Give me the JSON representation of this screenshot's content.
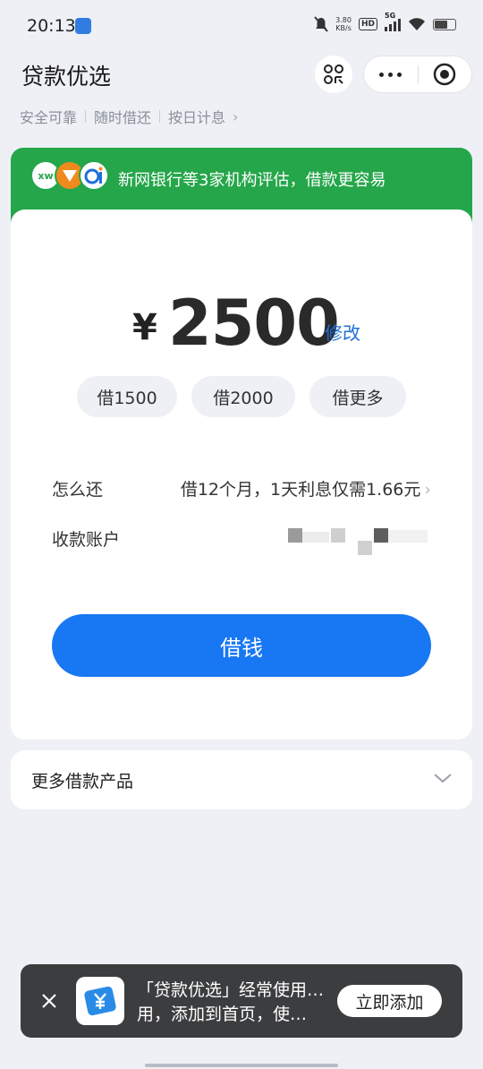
{
  "status_bar": {
    "time": "20:13",
    "net_speed_value": "3.80",
    "net_speed_unit": "KB/s",
    "hd": "HD",
    "network": "5G",
    "battery_level": 0.6
  },
  "header": {
    "title": "贷款优选",
    "taglines": [
      "安全可靠",
      "随时借还",
      "按日计息"
    ],
    "tagline_chevron": "›"
  },
  "banner": {
    "logo_1": "xw",
    "text": "新网银行等3家机构评估，借款更容易",
    "color": "#25a64a"
  },
  "loan": {
    "currency": "¥",
    "amount": "2500",
    "edit_label": "修改",
    "chips": [
      "借1500",
      "借2000",
      "借更多"
    ],
    "repay_label": "怎么还",
    "repay_value": "借12个月，1天利息仅需1.66元",
    "account_label": "收款账户",
    "borrow_button": "借钱",
    "accent": "#1877f2"
  },
  "more_products": {
    "title": "更多借款产品"
  },
  "toast": {
    "line_1": "「贷款优选」经常使用，添加到首页，使用更方便",
    "line_2": "用，添加到首页，使…",
    "add_button": "立即添加"
  }
}
